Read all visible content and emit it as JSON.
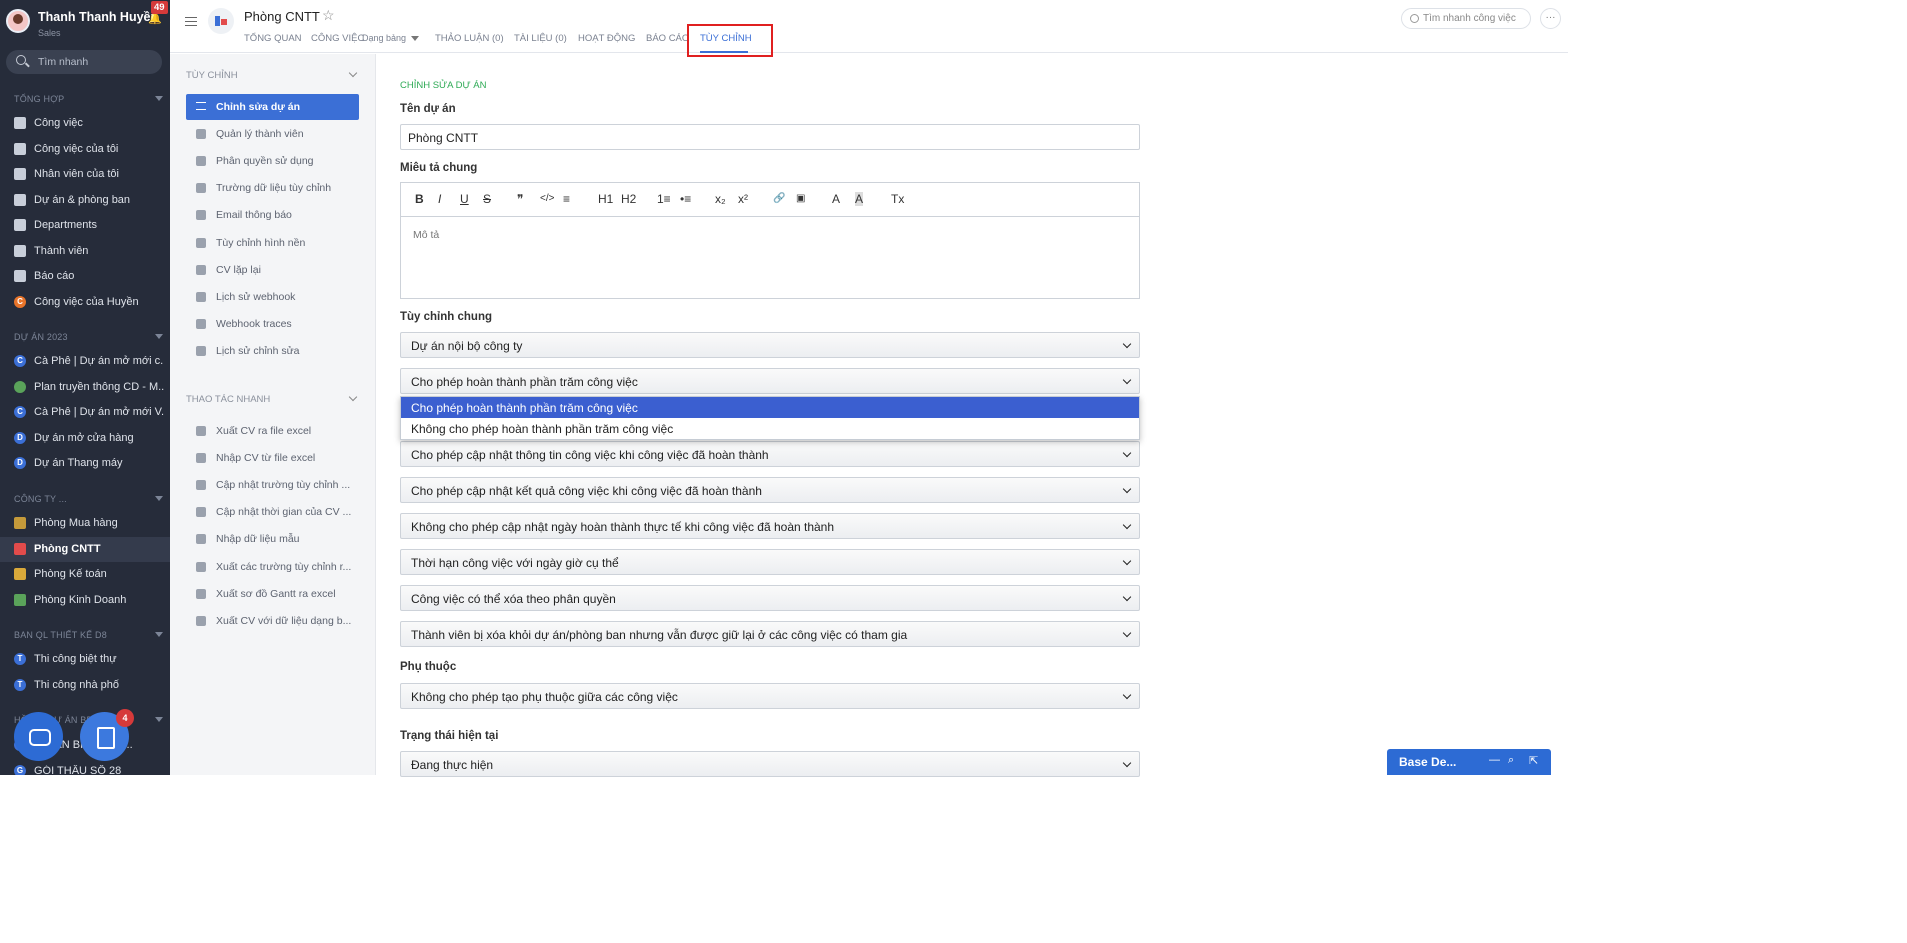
{
  "user": {
    "name": "Thanh Thanh Huyền",
    "role": "Sales",
    "notif_count": "49"
  },
  "sidebar": {
    "search_placeholder": "Tìm nhanh",
    "sections": {
      "general": "TỔNG HỢP",
      "projects_2023": "DỰ ÁN 2023",
      "company": "CÔNG TY ...",
      "design": "BAN QL THIẾT KẾ D8",
      "other": "HỒ SƠ DỰ ÁN BĐS"
    },
    "general_items": [
      {
        "label": "Công việc",
        "icon": "home-icon"
      },
      {
        "label": "Công việc của tôi",
        "icon": "checkbox-icon"
      },
      {
        "label": "Nhân viên của tôi",
        "icon": "people-icon"
      },
      {
        "label": "Dự án & phòng ban",
        "icon": "folder-icon"
      },
      {
        "label": "Departments",
        "icon": "departments-icon"
      },
      {
        "label": "Thành viên",
        "icon": "member-icon"
      },
      {
        "label": "Báo cáo",
        "icon": "chart-icon"
      },
      {
        "label": "Công việc của Huyền",
        "icon": "avatar-c-icon"
      }
    ],
    "project_items": [
      {
        "label": "Cà Phê | Dự án mở mới c...",
        "badge": "C",
        "color": "#3b6fd6"
      },
      {
        "label": "Plan truyền thông CD - M...",
        "badge": "",
        "color": "#5aa35a"
      },
      {
        "label": "Cà Phê | Dự án mở mới V...",
        "badge": "C",
        "color": "#3b6fd6"
      },
      {
        "label": "Dự án mở cửa hàng",
        "badge": "D",
        "color": "#3b6fd6"
      },
      {
        "label": "Dự án Thang máy",
        "badge": "D",
        "color": "#3b6fd6"
      }
    ],
    "company_items": [
      {
        "label": "Phòng Mua hàng",
        "color": "#c49a3a"
      },
      {
        "label": "Phòng CNTT",
        "color": "#e24b4b"
      },
      {
        "label": "Phòng Kế toán",
        "color": "#d9a93a"
      },
      {
        "label": "Phòng Kinh Doanh",
        "color": "#5aa35a"
      }
    ],
    "design_items": [
      {
        "label": "Thi công biệt thự",
        "badge": "T",
        "color": "#3b6fd6"
      },
      {
        "label": "Thi công nhà phố",
        "badge": "T",
        "color": "#3b6fd6"
      }
    ],
    "other_items": [
      {
        "label": "DỰ ÁN BÌNH HẢI ...",
        "badge": "D",
        "color": "#3b6fd6"
      },
      {
        "label": "GÓI THẦU SỐ 28",
        "badge": "G",
        "color": "#3b6fd6"
      }
    ],
    "task_badge": "4"
  },
  "header": {
    "title": "Phòng CNTT",
    "tabs": [
      "TỔNG QUAN",
      "CÔNG VIỆC",
      "THẢO LUẬN (0)",
      "TÀI LIỆU (0)",
      "HOẠT ĐỘNG",
      "BÁO CÁO",
      "TÙY CHỈNH"
    ],
    "view_mode": "Dạng bảng",
    "search_placeholder": "Tìm nhanh công việc",
    "more": "···"
  },
  "submenu": {
    "section1": "TÙY CHỈNH",
    "items1": [
      "Chỉnh sửa dự án",
      "Quản lý thành viên",
      "Phân quyền sử dụng",
      "Trường dữ liệu tùy chỉnh",
      "Email thông báo",
      "Tùy chỉnh hình nền",
      "CV lặp lại",
      "Lịch sử webhook",
      "Webhook traces",
      "Lịch sử chỉnh sửa"
    ],
    "section2": "THAO TÁC NHANH",
    "items2": [
      "Xuất CV ra file excel",
      "Nhập CV từ file excel",
      "Cập nhật trường tùy chỉnh ...",
      "Cập nhật thời gian của CV ...",
      "Nhập dữ liệu mẫu",
      "Xuất các trường tùy chỉnh r...",
      "Xuất sơ đồ Gantt ra excel",
      "Xuất CV với dữ liệu dạng b..."
    ]
  },
  "form": {
    "section_title": "CHỈNH SỬA DỰ ÁN",
    "name_label": "Tên dự án",
    "name_value": "Phòng CNTT",
    "desc_label": "Miêu tả chung",
    "desc_placeholder": "Mô tả",
    "toolbar": [
      "B",
      "I",
      "U",
      "S",
      "❞",
      "</>",
      "≡",
      "H1",
      "H2",
      "1≡",
      "•≡",
      "x₂",
      "x²",
      "🔗",
      "▣",
      "A",
      "A",
      "Tx"
    ],
    "general_label": "Tùy chỉnh chung",
    "selects": [
      "Dự án nội bộ công ty",
      "Cho phép hoàn thành phần trăm công việc",
      "Cho phép cập nhật thông tin công việc khi công việc đã hoàn thành",
      "Cho phép cập nhật kết quả công việc khi công việc đã hoàn thành",
      "Không cho phép cập nhật ngày hoàn thành thực tế khi công việc đã hoàn thành",
      "Thời hạn công việc với ngày giờ cụ thể",
      "Công việc có thể xóa theo phân quyền",
      "Thành viên bị xóa khỏi dự án/phòng ban nhưng vẫn được giữ lại ở các công việc có tham gia"
    ],
    "dropdown_options": [
      "Cho phép hoàn thành phần trăm công việc",
      "Không cho phép hoàn thành phần trăm công việc"
    ],
    "dependency_label": "Phụ thuộc",
    "dependency_value": "Không cho phép tạo phụ thuộc giữa các công việc",
    "status_label": "Trạng thái hiện tại",
    "status_value": "Đang thực hiện"
  },
  "base_bar": {
    "title": "Base De..."
  }
}
